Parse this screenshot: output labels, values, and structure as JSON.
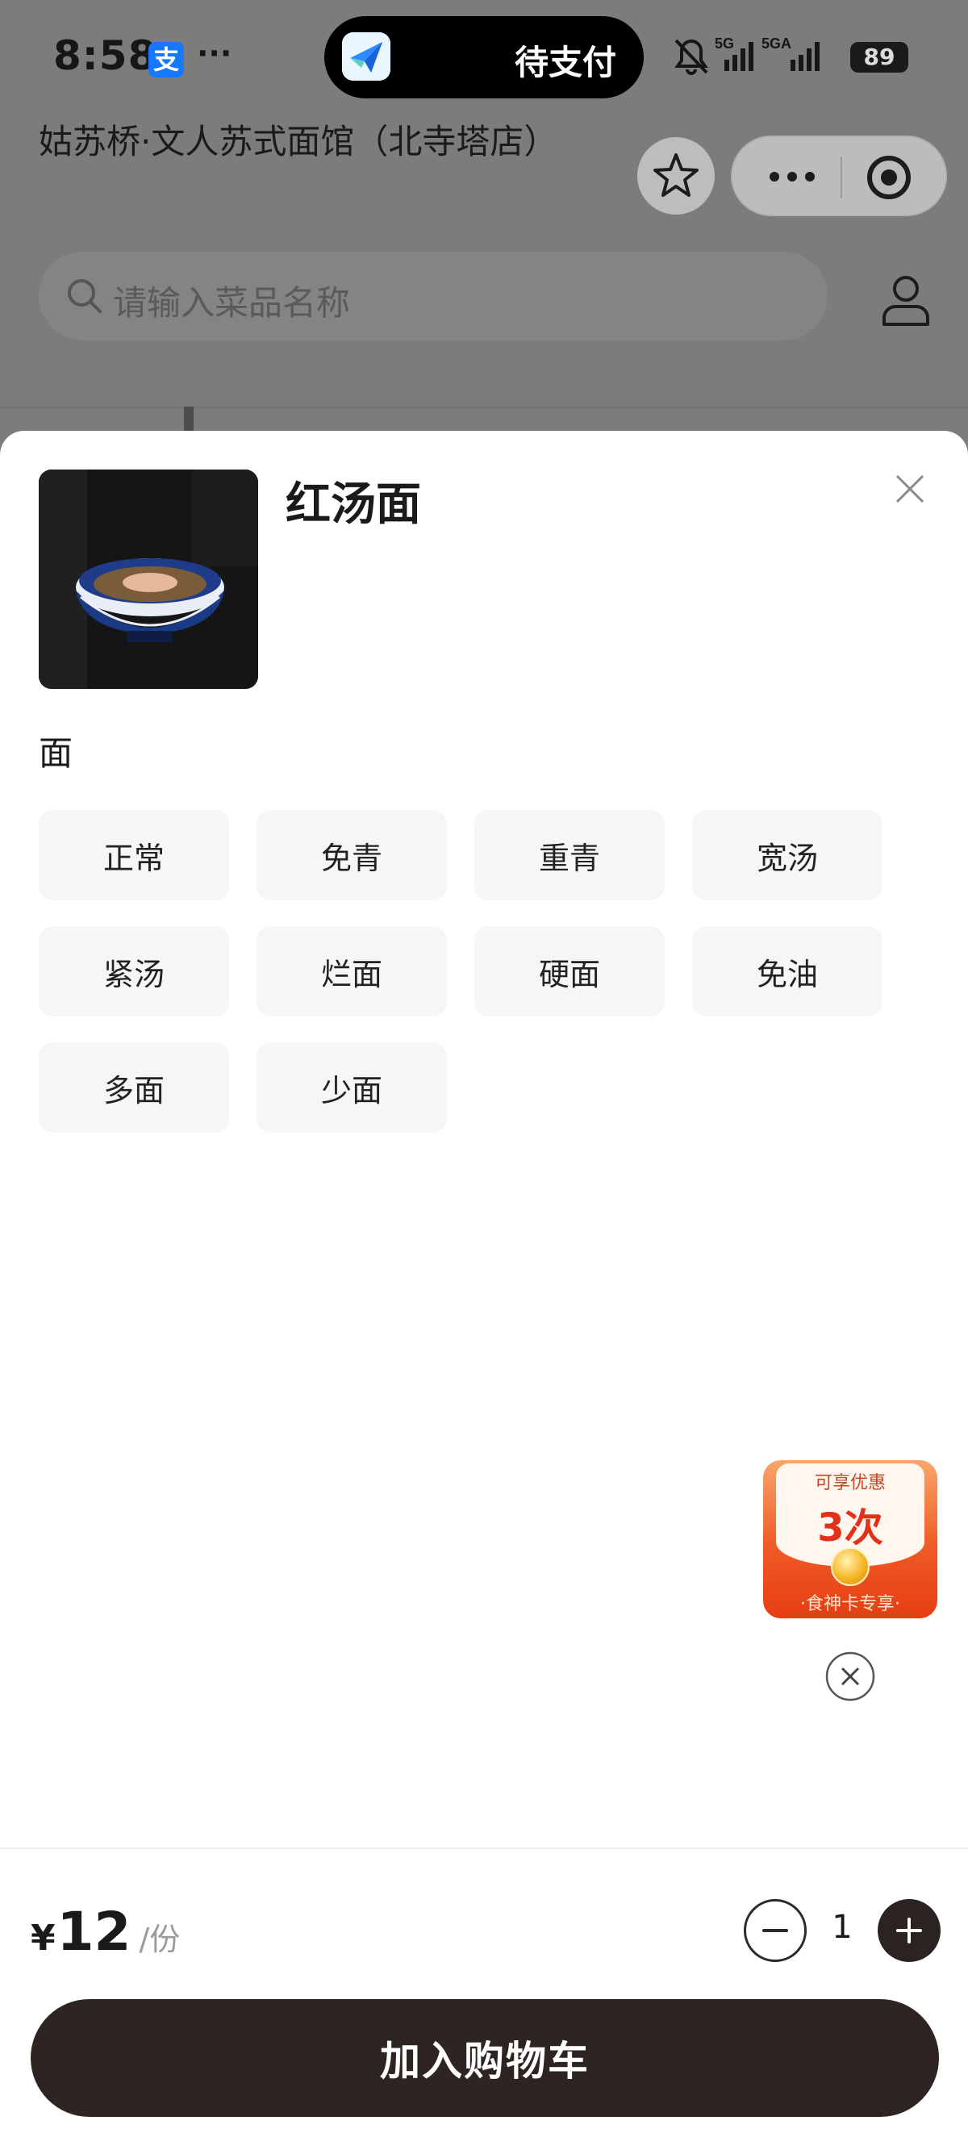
{
  "status_bar": {
    "time": "8:58",
    "alipay_badge": "支",
    "more": "···",
    "island_text": "待支付",
    "battery": "89",
    "network_1": "5G",
    "network_2": "5GA"
  },
  "header": {
    "store_name": "姑苏桥·文人苏式面馆（北寺塔店）"
  },
  "search": {
    "placeholder": "请输入菜品名称"
  },
  "dish": {
    "name": "红汤面"
  },
  "options_group": {
    "title": "面",
    "items": [
      "正常",
      "免青",
      "重青",
      "宽汤",
      "紧汤",
      "烂面",
      "硬面",
      "免油",
      "多面",
      "少面"
    ]
  },
  "promo": {
    "label": "可享优惠",
    "count": "3次",
    "footer": "·食神卡专享·"
  },
  "footer": {
    "currency": "¥",
    "price": "12",
    "unit": "/份",
    "quantity": "1",
    "add_to_cart": "加入购物车"
  },
  "colors": {
    "primary_dark": "#2e2422",
    "chip_bg": "#f5f6f8",
    "promo_red": "#e63d14",
    "overlay": "#7c7c7c"
  }
}
